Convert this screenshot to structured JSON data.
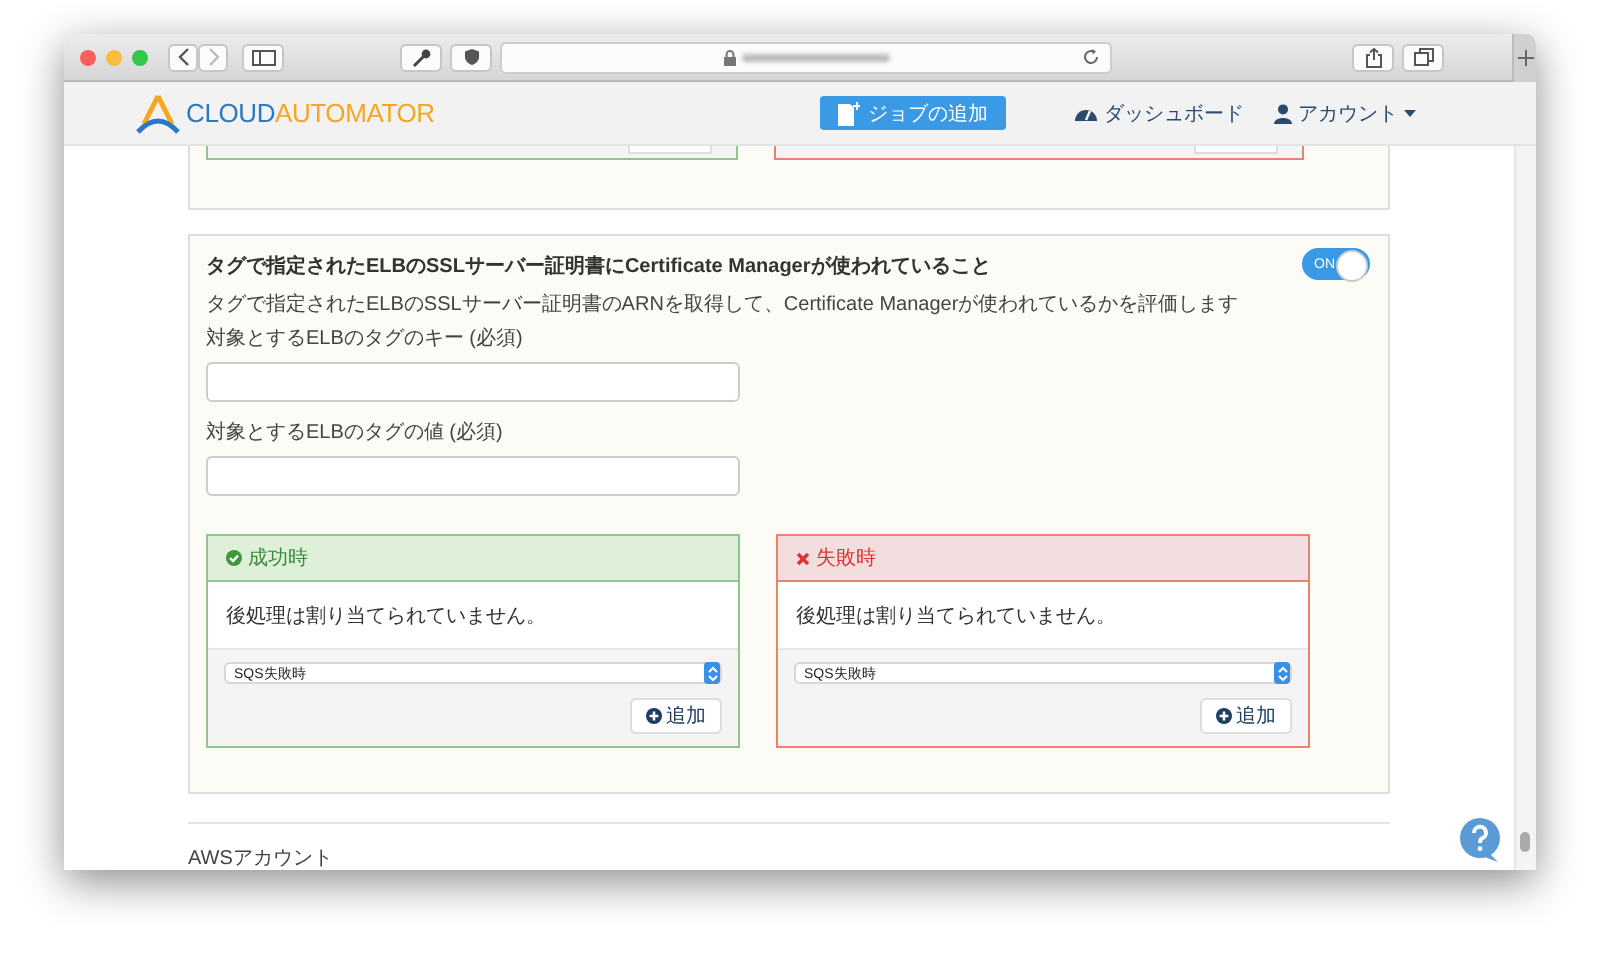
{
  "nav": {
    "logo": [
      {
        "text": "CLOUD",
        "kind": "primary"
      },
      {
        "text": "AUTOMATOR",
        "kind": "accent"
      }
    ],
    "add_job_button": "ジョブの追加",
    "dashboard_link": "ダッシュボード",
    "account_menu": "アカウント"
  },
  "rule": {
    "title": "タグで指定されたELBのSSLサーバー証明書にCertificate Managerが使われていること",
    "toggle": {
      "label": "ON",
      "on": true
    },
    "description": "タグで指定されたELBのSSLサーバー証明書のARNを取得して、Certificate Managerが使われているかを評価します",
    "fields": [
      {
        "label": "対象とするELBのタグのキー (必須)"
      },
      {
        "label": "対象とするELBのタグの値 (必須)"
      }
    ],
    "handlers": [
      {
        "kind": "success",
        "heading": "成功時",
        "message": "後処理は割り当てられていません。",
        "select_value": "SQS失敗時",
        "add_button": "追加"
      },
      {
        "kind": "failure",
        "heading": "失敗時",
        "message": "後処理は割り当てられていません。",
        "select_value": "SQS失敗時",
        "add_button": "追加"
      }
    ]
  },
  "section_label": "AWSアカウント"
}
